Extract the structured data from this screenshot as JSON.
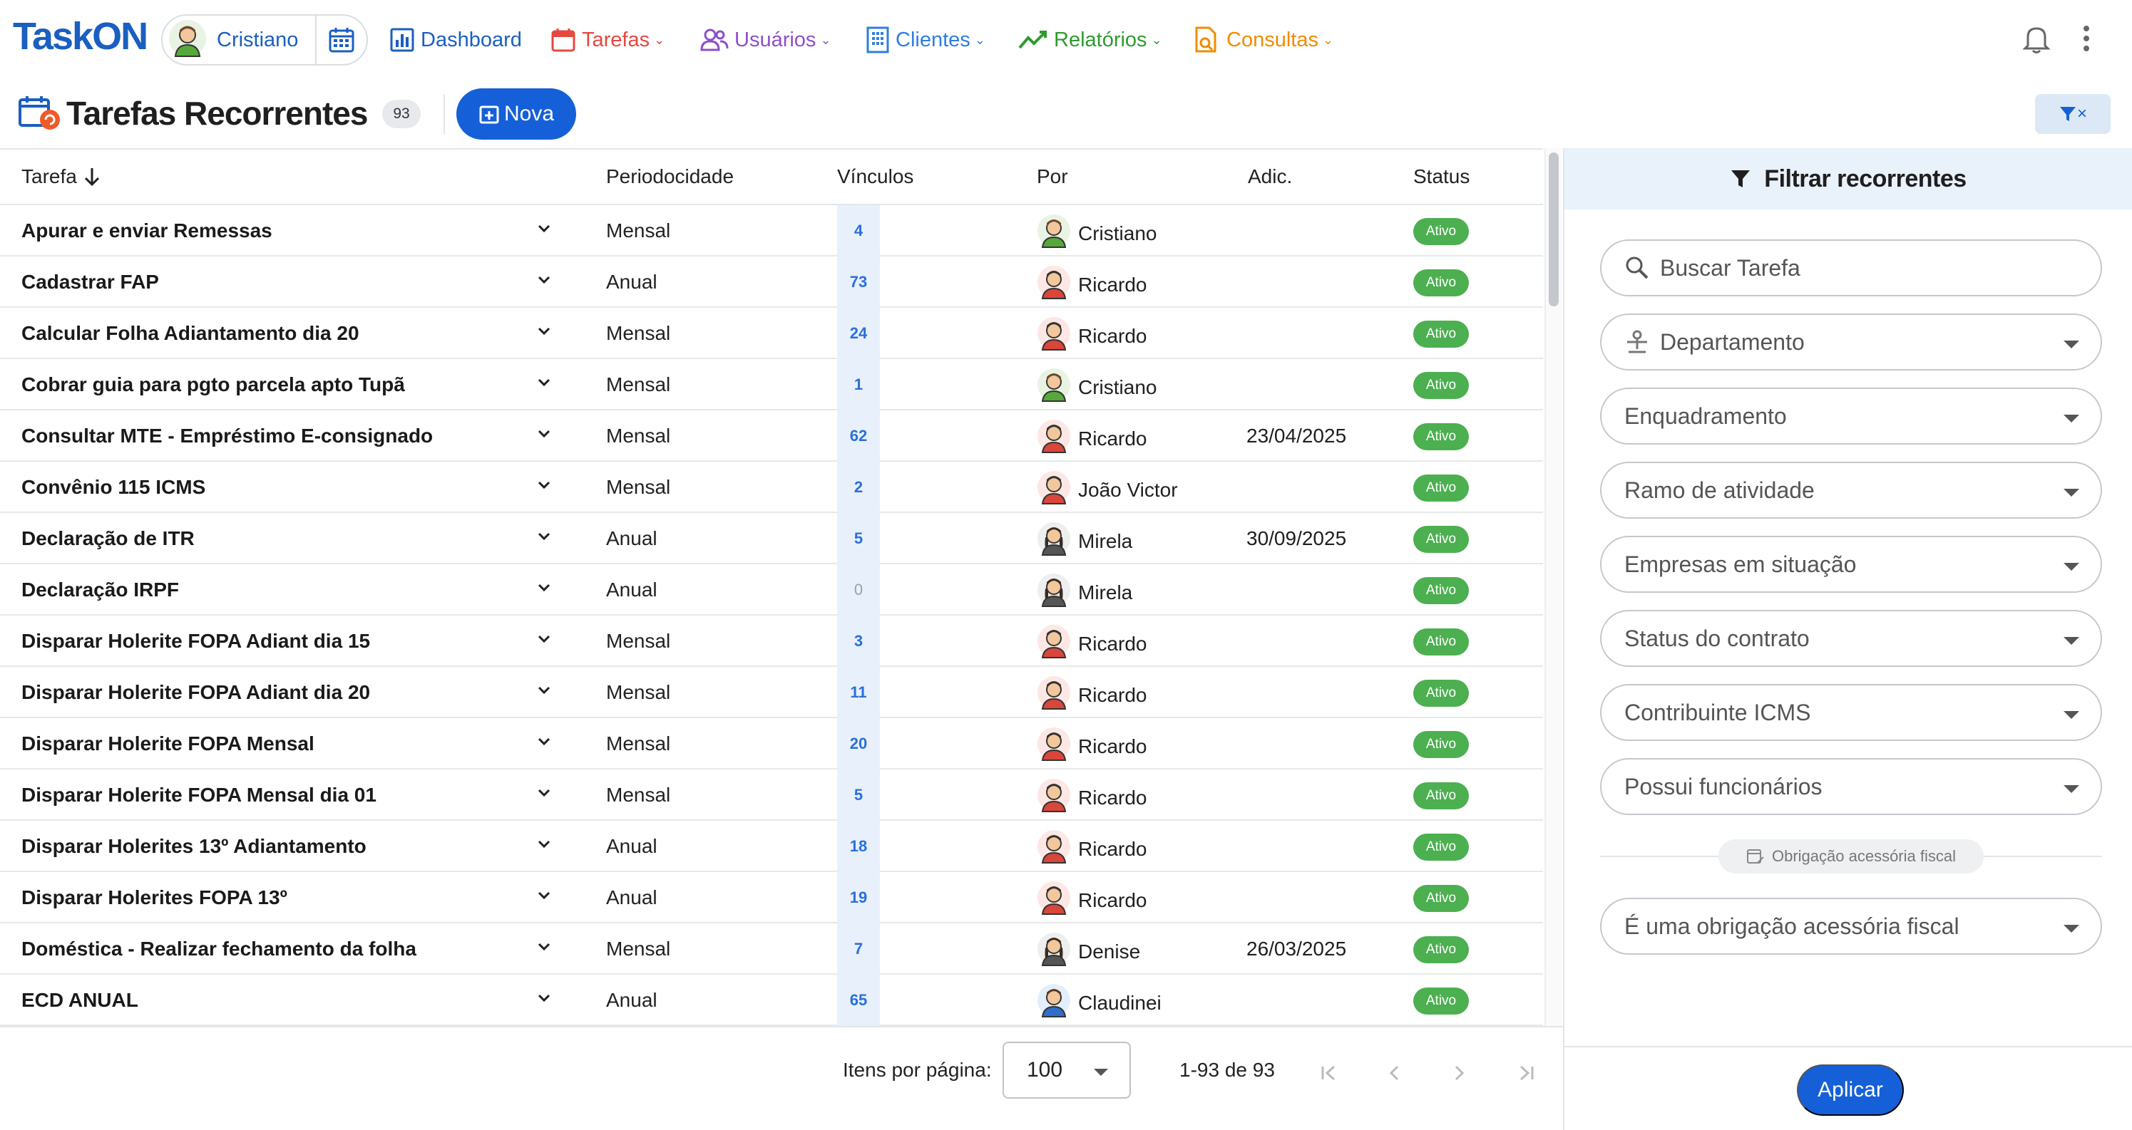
{
  "app": {
    "logo_text": "TaskON",
    "brand_color": "#1a5fc1"
  },
  "user": {
    "name": "Cristiano"
  },
  "nav": {
    "items": [
      {
        "label": "Dashboard",
        "icon": "bar-chart-icon",
        "color": "#1a5fc1",
        "has_menu": false
      },
      {
        "label": "Tarefas",
        "icon": "calendar-icon",
        "color": "#e5483f",
        "has_menu": true
      },
      {
        "label": "Usuários",
        "icon": "users-icon",
        "color": "#8e4fc9",
        "has_menu": true
      },
      {
        "label": "Clientes",
        "icon": "building-icon",
        "color": "#2f7de1",
        "has_menu": true
      },
      {
        "label": "Relatórios",
        "icon": "trend-icon",
        "color": "#2e9a2f",
        "has_menu": true
      },
      {
        "label": "Consultas",
        "icon": "document-search-icon",
        "color": "#f08c00",
        "has_menu": true
      }
    ]
  },
  "page": {
    "title": "Tarefas Recorrentes",
    "count": "93",
    "new_button": "Nova",
    "filter_toggle_close": "×"
  },
  "table": {
    "headers": {
      "task": "Tarefa",
      "periodicity": "Periodocidade",
      "links": "Vínculos",
      "by": "Por",
      "added": "Adic.",
      "status": "Status"
    },
    "rows": [
      {
        "task": "Apurar e enviar Remessas",
        "periodicity": "Mensal",
        "links": "4",
        "by": "Cristiano",
        "avatar": "man-green-avatar",
        "added": "",
        "status": "Ativo"
      },
      {
        "task": "Cadastrar FAP",
        "periodicity": "Anual",
        "links": "73",
        "by": "Ricardo",
        "avatar": "man-red-avatar",
        "added": "",
        "status": "Ativo"
      },
      {
        "task": "Calcular Folha Adiantamento dia 20",
        "periodicity": "Mensal",
        "links": "24",
        "by": "Ricardo",
        "avatar": "man-red-avatar",
        "added": "",
        "status": "Ativo"
      },
      {
        "task": "Cobrar guia para pgto parcela apto Tupã",
        "periodicity": "Mensal",
        "links": "1",
        "by": "Cristiano",
        "avatar": "man-green-avatar",
        "added": "",
        "status": "Ativo"
      },
      {
        "task": "Consultar MTE - Empréstimo E-consignado",
        "periodicity": "Mensal",
        "links": "62",
        "by": "Ricardo",
        "avatar": "man-red-avatar",
        "added": "23/04/2025",
        "status": "Ativo"
      },
      {
        "task": "Convênio 115 ICMS",
        "periodicity": "Mensal",
        "links": "2",
        "by": "João Victor",
        "avatar": "man-red-avatar",
        "added": "",
        "status": "Ativo"
      },
      {
        "task": "Declaração de ITR",
        "periodicity": "Anual",
        "links": "5",
        "by": "Mirela",
        "avatar": "woman-avatar",
        "added": "30/09/2025",
        "status": "Ativo"
      },
      {
        "task": "Declaração IRPF",
        "periodicity": "Anual",
        "links": "0",
        "by": "Mirela",
        "avatar": "woman-avatar",
        "added": "",
        "status": "Ativo"
      },
      {
        "task": "Disparar Holerite FOPA Adiant dia 15",
        "periodicity": "Mensal",
        "links": "3",
        "by": "Ricardo",
        "avatar": "man-red-avatar",
        "added": "",
        "status": "Ativo"
      },
      {
        "task": "Disparar Holerite FOPA Adiant dia 20",
        "periodicity": "Mensal",
        "links": "11",
        "by": "Ricardo",
        "avatar": "man-red-avatar",
        "added": "",
        "status": "Ativo"
      },
      {
        "task": "Disparar Holerite FOPA Mensal",
        "periodicity": "Mensal",
        "links": "20",
        "by": "Ricardo",
        "avatar": "man-red-avatar",
        "added": "",
        "status": "Ativo"
      },
      {
        "task": "Disparar Holerite FOPA Mensal dia 01",
        "periodicity": "Mensal",
        "links": "5",
        "by": "Ricardo",
        "avatar": "man-red-avatar",
        "added": "",
        "status": "Ativo"
      },
      {
        "task": "Disparar Holerites 13º Adiantamento",
        "periodicity": "Anual",
        "links": "18",
        "by": "Ricardo",
        "avatar": "man-red-avatar",
        "added": "",
        "status": "Ativo"
      },
      {
        "task": "Disparar Holerites FOPA 13º",
        "periodicity": "Anual",
        "links": "19",
        "by": "Ricardo",
        "avatar": "man-red-avatar",
        "added": "",
        "status": "Ativo"
      },
      {
        "task": "Doméstica - Realizar fechamento da folha",
        "periodicity": "Mensal",
        "links": "7",
        "by": "Denise",
        "avatar": "woman-avatar",
        "added": "26/03/2025",
        "status": "Ativo"
      },
      {
        "task": "ECD ANUAL",
        "periodicity": "Anual",
        "links": "65",
        "by": "Claudinei",
        "avatar": "man-blue-avatar",
        "added": "",
        "status": "Ativo"
      }
    ]
  },
  "pagination": {
    "items_per_page_label": "Itens por página:",
    "items_per_page": "100",
    "range": "1-93 de 93"
  },
  "filters": {
    "title": "Filtrar recorrentes",
    "search_placeholder": "Buscar Tarefa",
    "department": "Departamento",
    "enquadramento": "Enquadramento",
    "ramo": "Ramo de atividade",
    "empresas_situacao": "Empresas em situação",
    "status_contrato": "Status do contrato",
    "contribuinte_icms": "Contribuinte ICMS",
    "possui_funcionarios": "Possui funcionários",
    "section_chip": "Obrigação acessória fiscal",
    "obrigacao": "É uma obrigação acessória fiscal",
    "apply_button": "Aplicar"
  },
  "colors": {
    "primary": "#1560d8",
    "status_active": "#4caf50",
    "links_cell": "#e8f0fb",
    "filter_header": "#e9f1fb"
  }
}
